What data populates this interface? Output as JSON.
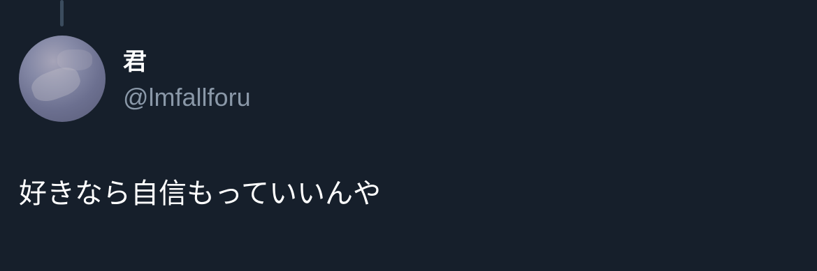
{
  "tweet": {
    "author": {
      "display_name": "君",
      "handle": "@lmfallforu"
    },
    "text": "好きなら自信もっていいんや"
  },
  "colors": {
    "background": "#161f2b",
    "thread_line": "#3b4c5e",
    "name": "#ffffff",
    "handle": "#8a98a8",
    "text": "#ffffff"
  }
}
